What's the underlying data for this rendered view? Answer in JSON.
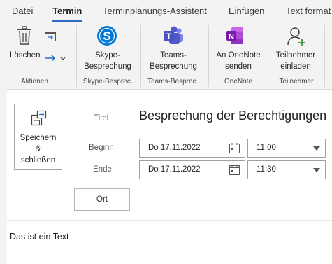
{
  "menu": {
    "tabs": [
      "Datei",
      "Termin",
      "Terminplanungs-Assistent",
      "Einfügen",
      "Text format"
    ]
  },
  "ribbon": {
    "delete_label": "Löschen",
    "skype_label_1": "Skype-",
    "skype_label_2": "Besprechung",
    "teams_label_1": "Teams-",
    "teams_label_2": "Besprechung",
    "onenote_label_1": "An OneNote",
    "onenote_label_2": "senden",
    "invite_label_1": "Teilnehmer",
    "invite_label_2": "einladen",
    "groups": {
      "actions": "Aktionen",
      "skype": "Skype-Besprec...",
      "teams": "Teams-Besprec...",
      "onenote": "OneNote",
      "attendees": "Teilnehmer"
    }
  },
  "form": {
    "save_line1": "Speichern",
    "save_line2": "&",
    "save_line3": "schließen",
    "title_label": "Titel",
    "title_value": "Besprechung der Berechtigungen",
    "start_label": "Beginn",
    "start_date": "Do 17.11.2022",
    "start_time": "11:00",
    "end_label": "Ende",
    "end_date": "Do 17.11.2022",
    "end_time": "11:30",
    "location_button": "Ort",
    "location_value": ""
  },
  "body": {
    "text": "Das ist ein Text"
  },
  "colors": {
    "accent": "#2b6cc4",
    "skype": "#0078d4",
    "teams": "#5059c9",
    "onenote": "#7719aa",
    "invite_plus": "#3a9a3a"
  }
}
